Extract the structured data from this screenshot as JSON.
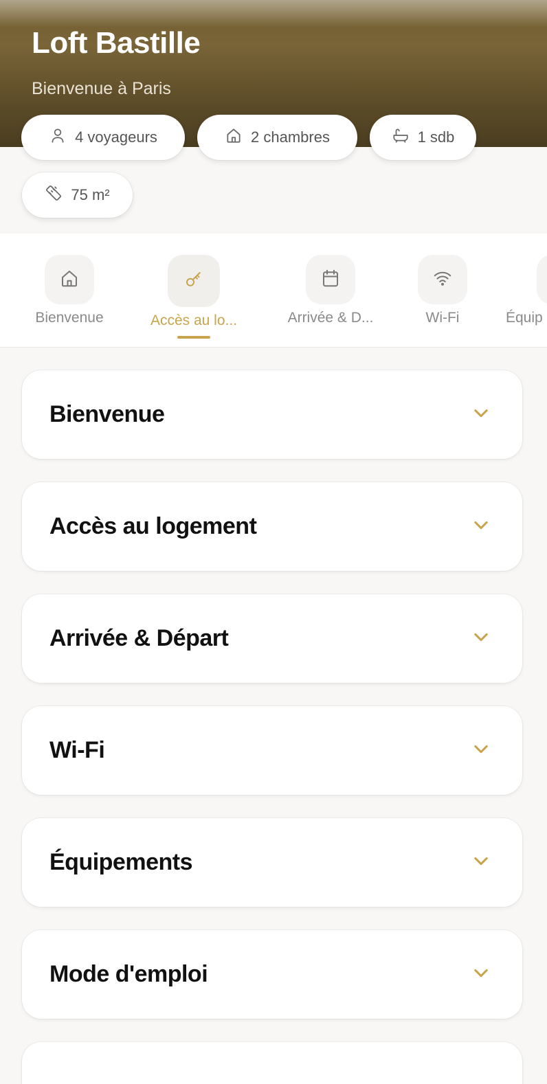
{
  "header": {
    "title": "Loft Bastille",
    "subtitle": "Bienvenue à Paris"
  },
  "chips": [
    {
      "label": "4 voyageurs",
      "icon": "person-icon"
    },
    {
      "label": "2 chambres",
      "icon": "home-icon"
    },
    {
      "label": "1 sdb",
      "icon": "bathtub-icon"
    },
    {
      "label": "75 m²",
      "icon": "ruler-icon"
    }
  ],
  "tabs": [
    {
      "label": "Bienvenue",
      "icon": "home-icon",
      "active": false
    },
    {
      "label": "Accès au lo...",
      "icon": "key-icon",
      "active": true
    },
    {
      "label": "Arrivée & D...",
      "icon": "calendar-icon",
      "active": false
    },
    {
      "label": "Wi-Fi",
      "icon": "wifi-icon",
      "active": false
    },
    {
      "label": "Équip",
      "icon": "equipment-icon",
      "active": false
    }
  ],
  "sections": [
    {
      "title": "Bienvenue"
    },
    {
      "title": "Accès au logement"
    },
    {
      "title": "Arrivée & Départ"
    },
    {
      "title": "Wi-Fi"
    },
    {
      "title": "Équipements"
    },
    {
      "title": "Mode d'emploi"
    },
    {
      "title": ""
    }
  ],
  "colors": {
    "accent": "#c8a54c",
    "hero": "#6f5c2e",
    "background": "#f8f7f5"
  }
}
